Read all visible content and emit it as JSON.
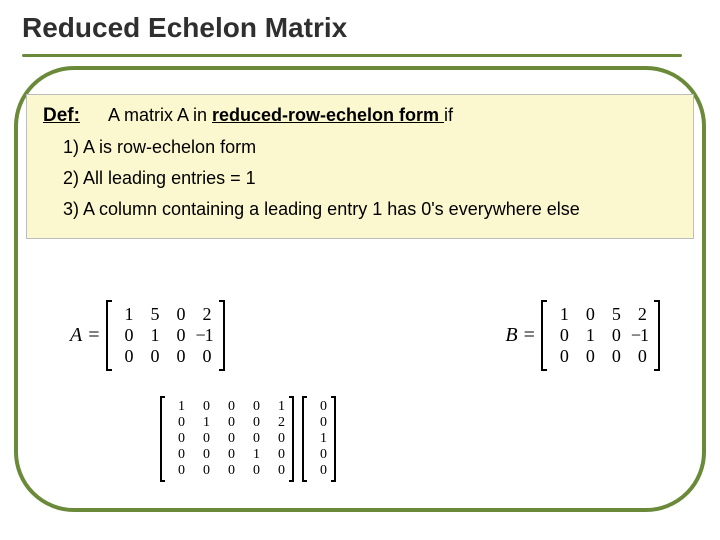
{
  "title": "Reduced Echelon Matrix",
  "def": {
    "label": "Def:",
    "lead_pre": "A matrix  A  in ",
    "lead_u": "reduced-row-echelon form ",
    "lead_post": " if",
    "items": [
      "1)   A is row-echelon form",
      "2)   All leading entries  =   1",
      "3)   A column containing a leading entry  1  has   0's everywhere else"
    ]
  },
  "matrixA": {
    "name": "A",
    "eq": "=",
    "rows": [
      [
        "1",
        "5",
        "0",
        "2"
      ],
      [
        "0",
        "1",
        "0",
        "−1"
      ],
      [
        "0",
        "0",
        "0",
        "0"
      ]
    ]
  },
  "matrixB": {
    "name": "B",
    "eq": "=",
    "rows": [
      [
        "1",
        "0",
        "5",
        "2"
      ],
      [
        "0",
        "1",
        "0",
        "−1"
      ],
      [
        "0",
        "0",
        "0",
        "0"
      ]
    ]
  },
  "matrixC": {
    "rows": [
      [
        "1",
        "0",
        "0",
        "0",
        "1"
      ],
      [
        "0",
        "1",
        "0",
        "0",
        "2"
      ],
      [
        "0",
        "0",
        "0",
        "0",
        "0"
      ],
      [
        "0",
        "0",
        "0",
        "1",
        "0"
      ],
      [
        "0",
        "0",
        "0",
        "0",
        "0"
      ]
    ]
  },
  "matrixD": {
    "rows": [
      [
        "0"
      ],
      [
        "0"
      ],
      [
        "1"
      ],
      [
        "0"
      ],
      [
        "0"
      ]
    ]
  }
}
